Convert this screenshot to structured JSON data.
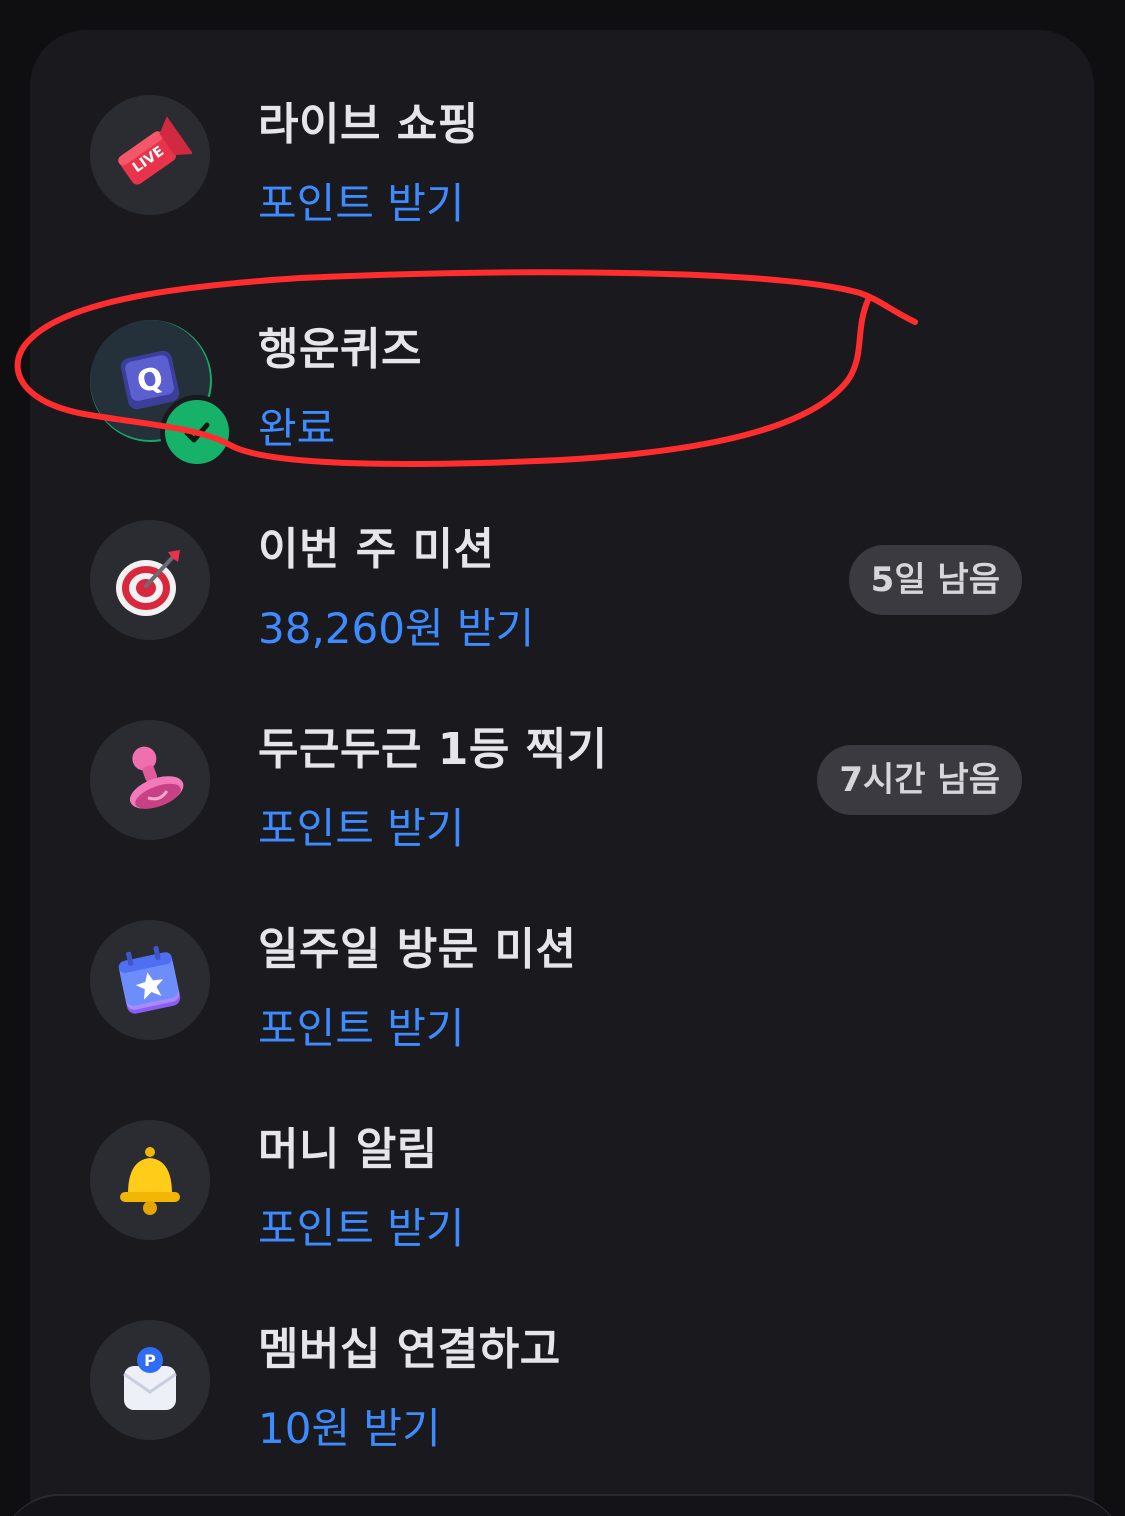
{
  "colors": {
    "background": "#0f0f12",
    "card": "#19191e",
    "title_text": "#e6e6ea",
    "action_text": "#3d8bff",
    "badge_bg": "#3a3a40",
    "badge_text": "#d6d6da",
    "complete_green": "#17b26a",
    "annotation_red": "#ff2d2d"
  },
  "missions": [
    {
      "title": "라이브 쇼핑",
      "action": "포인트 받기",
      "icon": "live-shopping-icon"
    },
    {
      "title": "행운퀴즈",
      "action": "완료",
      "icon": "quiz-q-icon",
      "completed": true
    },
    {
      "title": "이번 주 미션",
      "action": "38,260원 받기",
      "badge": "5일 남음",
      "icon": "target-dart-icon"
    },
    {
      "title": "두근두근 1등 찍기",
      "action": "포인트 받기",
      "badge": "7시간 남음",
      "icon": "stamp-icon"
    },
    {
      "title": "일주일 방문 미션",
      "action": "포인트 받기",
      "icon": "calendar-star-icon"
    },
    {
      "title": "머니 알림",
      "action": "포인트 받기",
      "icon": "bell-icon"
    },
    {
      "title": "멤버십 연결하고",
      "action": "10원 받기",
      "icon": "membership-envelope-icon"
    }
  ]
}
